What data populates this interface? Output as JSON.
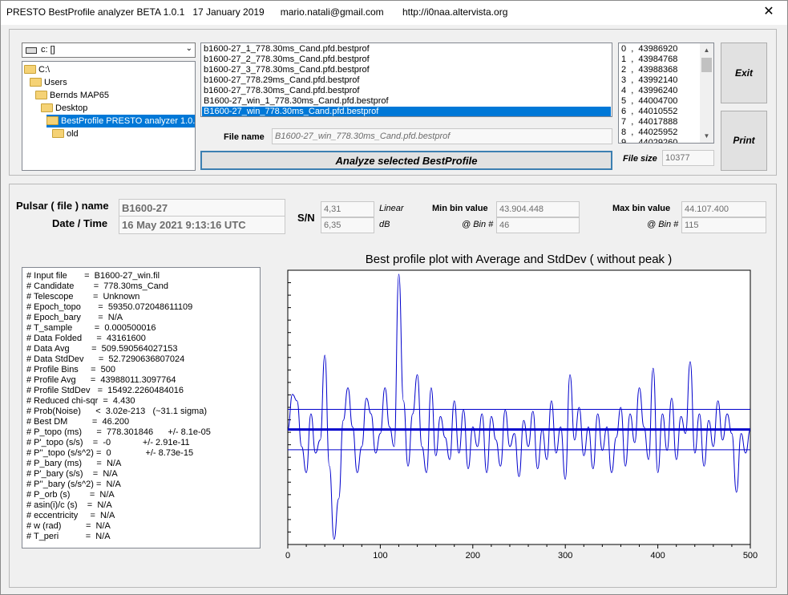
{
  "window": {
    "title": "PRESTO BestProfile analyzer BETA 1.0.1   17 January 2019      mario.natali@gmail.com       http://i0naa.altervista.org",
    "close_glyph": "✕"
  },
  "drive": {
    "label": "c: []",
    "arrow": "⌄"
  },
  "tree": [
    {
      "label": "C:\\",
      "indent": 0
    },
    {
      "label": "Users",
      "indent": 1
    },
    {
      "label": "Bernds MAP65",
      "indent": 2
    },
    {
      "label": "Desktop",
      "indent": 3
    },
    {
      "label": "BestProfile PRESTO analyzer 1.0.1.e",
      "indent": 4,
      "selected": true
    },
    {
      "label": "old",
      "indent": 5
    }
  ],
  "files": [
    {
      "name": "b1600-27_1_778.30ms_Cand.pfd.bestprof"
    },
    {
      "name": "b1600-27_2_778.30ms_Cand.pfd.bestprof"
    },
    {
      "name": "b1600-27_3_778.30ms_Cand.pfd.bestprof"
    },
    {
      "name": "b1600-27_778.29ms_Cand.pfd.bestprof"
    },
    {
      "name": "b1600-27_778.30ms_Cand.pfd.bestprof"
    },
    {
      "name": "B1600-27_win_1_778.30ms_Cand.pfd.bestprof"
    },
    {
      "name": "B1600-27_win_778.30ms_Cand.pfd.bestprof",
      "selected": true
    }
  ],
  "bins": [
    "0  ,  43986920",
    "1  ,  43984768",
    "2  ,  43988368",
    "3  ,  43992140",
    "4  ,  43996240",
    "5  ,  44004700",
    "6  ,  44010552",
    "7  ,  44017888",
    "8  ,  44025952",
    "9  ,  44029260"
  ],
  "buttons": {
    "exit": "Exit",
    "print": "Print",
    "analyze": "Analyze selected BestProfile"
  },
  "file_name": {
    "label": "File name",
    "value": "B1600-27_win_778.30ms_Cand.pfd.bestprof"
  },
  "file_size": {
    "label": "File size",
    "value": "10377"
  },
  "pulsar": {
    "label": "Pulsar ( file ) name",
    "value": "B1600-27"
  },
  "datetime": {
    "label": "Date / Time",
    "value": "16 May 2021     9:13:16  UTC"
  },
  "sn": {
    "label": "S/N",
    "linear": "4,31",
    "db": "6,35",
    "linear_label": "Linear",
    "db_label": "dB"
  },
  "min_bin": {
    "label": "Min bin value",
    "value": "43.904.448",
    "bin_label": "@ Bin #",
    "bin": "46"
  },
  "max_bin": {
    "label": "Max bin value",
    "value": "44.107.400",
    "bin_label": "@ Bin #",
    "bin": "115"
  },
  "info_lines": [
    "# Input file       =  B1600-27_win.fil",
    "# Candidate        =  778.30ms_Cand",
    "# Telescope        =  Unknown",
    "# Epoch_topo       =  59350.072048611109",
    "# Epoch_bary       =  N/A",
    "# T_sample         =  0.000500016",
    "# Data Folded      =  43161600",
    "# Data Avg         =  509.590564027153",
    "# Data StdDev      =  52.7290636807024",
    "# Profile Bins     =  500",
    "# Profile Avg      =  43988011.3097764",
    "# Profile StdDev   =  15492.2260484016",
    "# Reduced chi-sqr  =  4.430",
    "# Prob(Noise)      <  3.02e-213   (~31.1 sigma)",
    "# Best DM          =  46.200",
    "# P_topo (ms)      =  778.301846      +/- 8.1e-05",
    "# P'_topo (s/s)    =  -0             +/- 2.91e-11",
    "# P''_topo (s/s^2) =  0              +/- 8.73e-15",
    "# P_bary (ms)      =  N/A",
    "# P'_bary (s/s)    =  N/A",
    "# P''_bary (s/s^2) =  N/A",
    "# P_orb (s)        =  N/A",
    "# asin(i)/c (s)    =  N/A",
    "# eccentricity     =  N/A",
    "# w (rad)          =  N/A",
    "# T_peri           =  N/A"
  ],
  "chart_data": {
    "type": "line",
    "title": "Best profile plot with  Average and StdDev ( without peak )",
    "xlim": [
      0,
      500
    ],
    "ylim": [
      43900000,
      44110000
    ],
    "x_ticks": [
      "0",
      "100",
      "200",
      "300",
      "400",
      "500"
    ],
    "average": 43988011,
    "std_upper": 44003503,
    "std_lower": 43972519,
    "series": [
      {
        "x": [
          0,
          5,
          10,
          15,
          20,
          25,
          30,
          35,
          40,
          45,
          50,
          55,
          60,
          65,
          70,
          75,
          80,
          85,
          90,
          95,
          100,
          105,
          110,
          115,
          120,
          125,
          130,
          135,
          140,
          145,
          150,
          155,
          160,
          165,
          170,
          175,
          180,
          185,
          190,
          195,
          200,
          205,
          210,
          215,
          220,
          225,
          230,
          235,
          240,
          245,
          250,
          255,
          260,
          265,
          270,
          275,
          280,
          285,
          290,
          295,
          300,
          305,
          310,
          315,
          320,
          325,
          330,
          335,
          340,
          345,
          350,
          355,
          360,
          365,
          370,
          375,
          380,
          385,
          390,
          395,
          400,
          405,
          410,
          415,
          420,
          425,
          430,
          435,
          440,
          445,
          450,
          455,
          460,
          465,
          470,
          475,
          480,
          485,
          490,
          495,
          500
        ],
        "y": [
          43988000,
          44015000,
          44010000,
          43975000,
          43955000,
          44000000,
          43970000,
          43980000,
          44045000,
          43960000,
          43904000,
          43935000,
          43995000,
          44020000,
          43990000,
          43955000,
          43975000,
          44012000,
          44000000,
          43970000,
          43985000,
          44020000,
          43990000,
          43975000,
          44107000,
          44010000,
          43960000,
          44000000,
          44030000,
          43975000,
          43955000,
          44020000,
          43968000,
          43998000,
          43982000,
          43965000,
          44010000,
          43970000,
          44003000,
          43958000,
          43990000,
          43975000,
          44000000,
          43955000,
          43998000,
          43980000,
          43960000,
          44003000,
          43975000,
          43985000,
          43952000,
          43995000,
          43975000,
          44002000,
          43958000,
          43988000,
          43965000,
          44010000,
          43970000,
          43990000,
          43950000,
          44030000,
          43980000,
          44005000,
          43968000,
          43990000,
          43958000,
          44000000,
          43972000,
          43990000,
          43955000,
          43982000,
          44005000,
          43960000,
          44000000,
          43978000,
          44020000,
          43990000,
          43965000,
          44035000,
          43955000,
          44000000,
          43972000,
          44012000,
          43965000,
          43998000,
          43985000,
          44040000,
          43970000,
          44000000,
          43960000,
          43995000,
          43975000,
          44010000,
          43980000,
          44000000,
          43985000,
          43940000,
          43985000,
          43970000,
          43988000
        ]
      }
    ]
  }
}
